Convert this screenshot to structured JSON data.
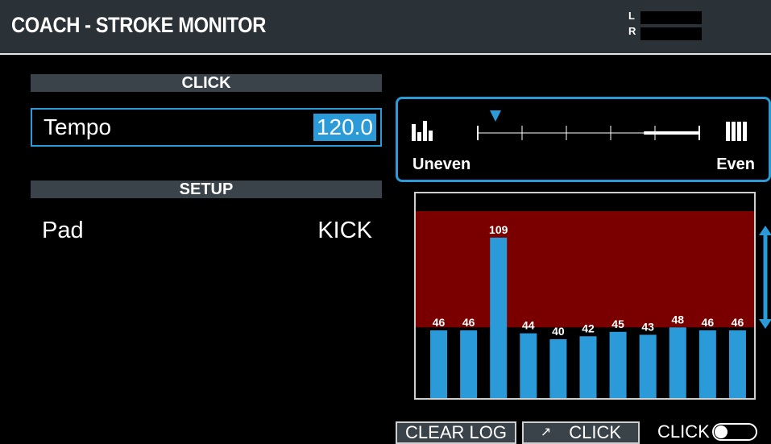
{
  "header": {
    "title": "COACH - STROKE MONITOR",
    "meter_l_label": "L",
    "meter_r_label": "R"
  },
  "click_section": {
    "title": "CLICK",
    "tempo_label": "Tempo",
    "tempo_value": "120.0"
  },
  "setup_section": {
    "title": "SETUP",
    "pad_label": "Pad",
    "pad_value": "KICK"
  },
  "evenness": {
    "left_label": "Uneven",
    "right_label": "Even",
    "marker_position": 0.0,
    "target_range": [
      0.75,
      1.0
    ],
    "tick_count": 5,
    "accent": "#2a9ad8"
  },
  "chart_data": {
    "type": "bar",
    "values": [
      46,
      46,
      109,
      44,
      40,
      42,
      45,
      43,
      48,
      46,
      46
    ],
    "ylim": [
      0,
      127
    ],
    "target_band": [
      48,
      127
    ],
    "bar_color": "#2a9ad8",
    "band_color": "#7a0000"
  },
  "footer": {
    "clear_log_label": "CLEAR LOG",
    "click_button_label": "CLICK",
    "click_toggle_label": "CLICK",
    "click_toggle_on": false
  },
  "colors": {
    "accent": "#2a9ad8",
    "header_bg": "#2a3137",
    "section_bg": "#3a434a"
  }
}
